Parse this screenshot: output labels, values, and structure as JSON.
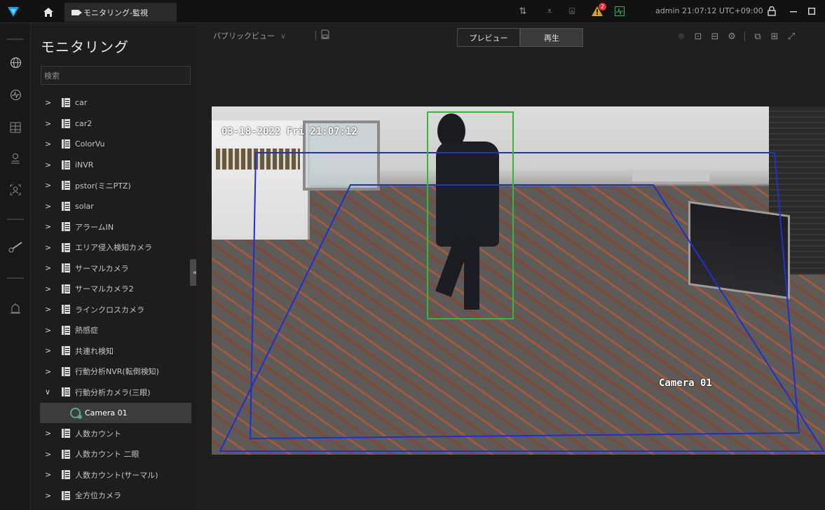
{
  "topbar": {
    "tab_label": "モニタリング-監視",
    "user": "admin",
    "clock": "21:07:12 UTC+09:00",
    "alarm_count": "2"
  },
  "sidebar": {
    "title": "モニタリング",
    "search_placeholder": "検索",
    "items": [
      {
        "label": "car",
        "expanded": false
      },
      {
        "label": "car2",
        "expanded": false
      },
      {
        "label": "ColorVu",
        "expanded": false
      },
      {
        "label": "iNVR",
        "expanded": false
      },
      {
        "label": "pstor(ミニPTZ)",
        "expanded": false
      },
      {
        "label": "solar",
        "expanded": false
      },
      {
        "label": "アラームIN",
        "expanded": false
      },
      {
        "label": "エリア侵入検知カメラ",
        "expanded": false
      },
      {
        "label": "サーマルカメラ",
        "expanded": false
      },
      {
        "label": "サーマルカメラ2",
        "expanded": false
      },
      {
        "label": "ラインクロスカメラ",
        "expanded": false
      },
      {
        "label": "熱感症",
        "expanded": false
      },
      {
        "label": "共連れ検知",
        "expanded": false
      },
      {
        "label": "行動分析NVR(転倒検知)",
        "expanded": false
      },
      {
        "label": "行動分析カメラ(三眼)",
        "expanded": true
      },
      {
        "label": "Camera 01",
        "selected": true,
        "child": true
      },
      {
        "label": "人数カウント",
        "expanded": false
      },
      {
        "label": "人数カウント 二眼",
        "expanded": false
      },
      {
        "label": "人数カウント(サーマル)",
        "expanded": false
      },
      {
        "label": "全方位カメラ",
        "expanded": false
      }
    ]
  },
  "main": {
    "view_select": "パブリックビュー",
    "mode_tabs": [
      "プレビュー",
      "再生"
    ],
    "active_mode": "プレビュー",
    "video": {
      "timestamp": "03-18-2022 Fri 21:07:12",
      "camera_label": "Camera 01"
    }
  },
  "colors": {
    "accent": "#1ea0e6",
    "detect_box": "#35b835",
    "zone": "#1f2fd0",
    "selected_row": "#3c3c3c"
  }
}
